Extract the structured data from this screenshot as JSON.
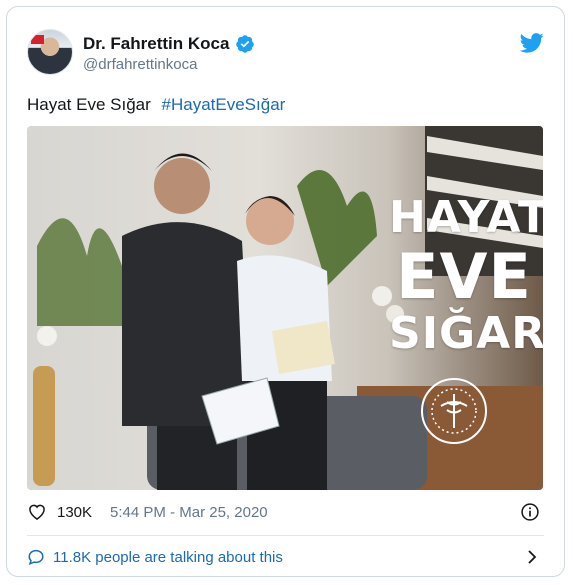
{
  "author": {
    "name": "Dr. Fahrettin Koca",
    "handle": "@drfahrettinkoca",
    "verified_icon": "verified-badge-icon",
    "platform_icon": "twitter-bird-icon"
  },
  "tweet": {
    "text": "Hayat Eve Sığar",
    "hashtag": "#HayatEveSığar"
  },
  "media": {
    "overlay_line1": "HAYAT",
    "overlay_line2": "EVE",
    "overlay_line3": "SIĞAR",
    "seal_icon": "ministry-seal-icon"
  },
  "footer": {
    "likes": "130K",
    "timestamp": "5:44 PM - Mar 25, 2020",
    "like_icon": "heart-icon",
    "info_icon": "info-icon"
  },
  "conversation": {
    "label": "11.8K people are talking about this",
    "icon": "speech-bubble-icon",
    "chevron": "chevron-right-icon"
  },
  "colors": {
    "link": "#1b6ab3",
    "twitter_blue": "#1da1f2",
    "muted": "#657786",
    "border": "#cfd9de"
  }
}
